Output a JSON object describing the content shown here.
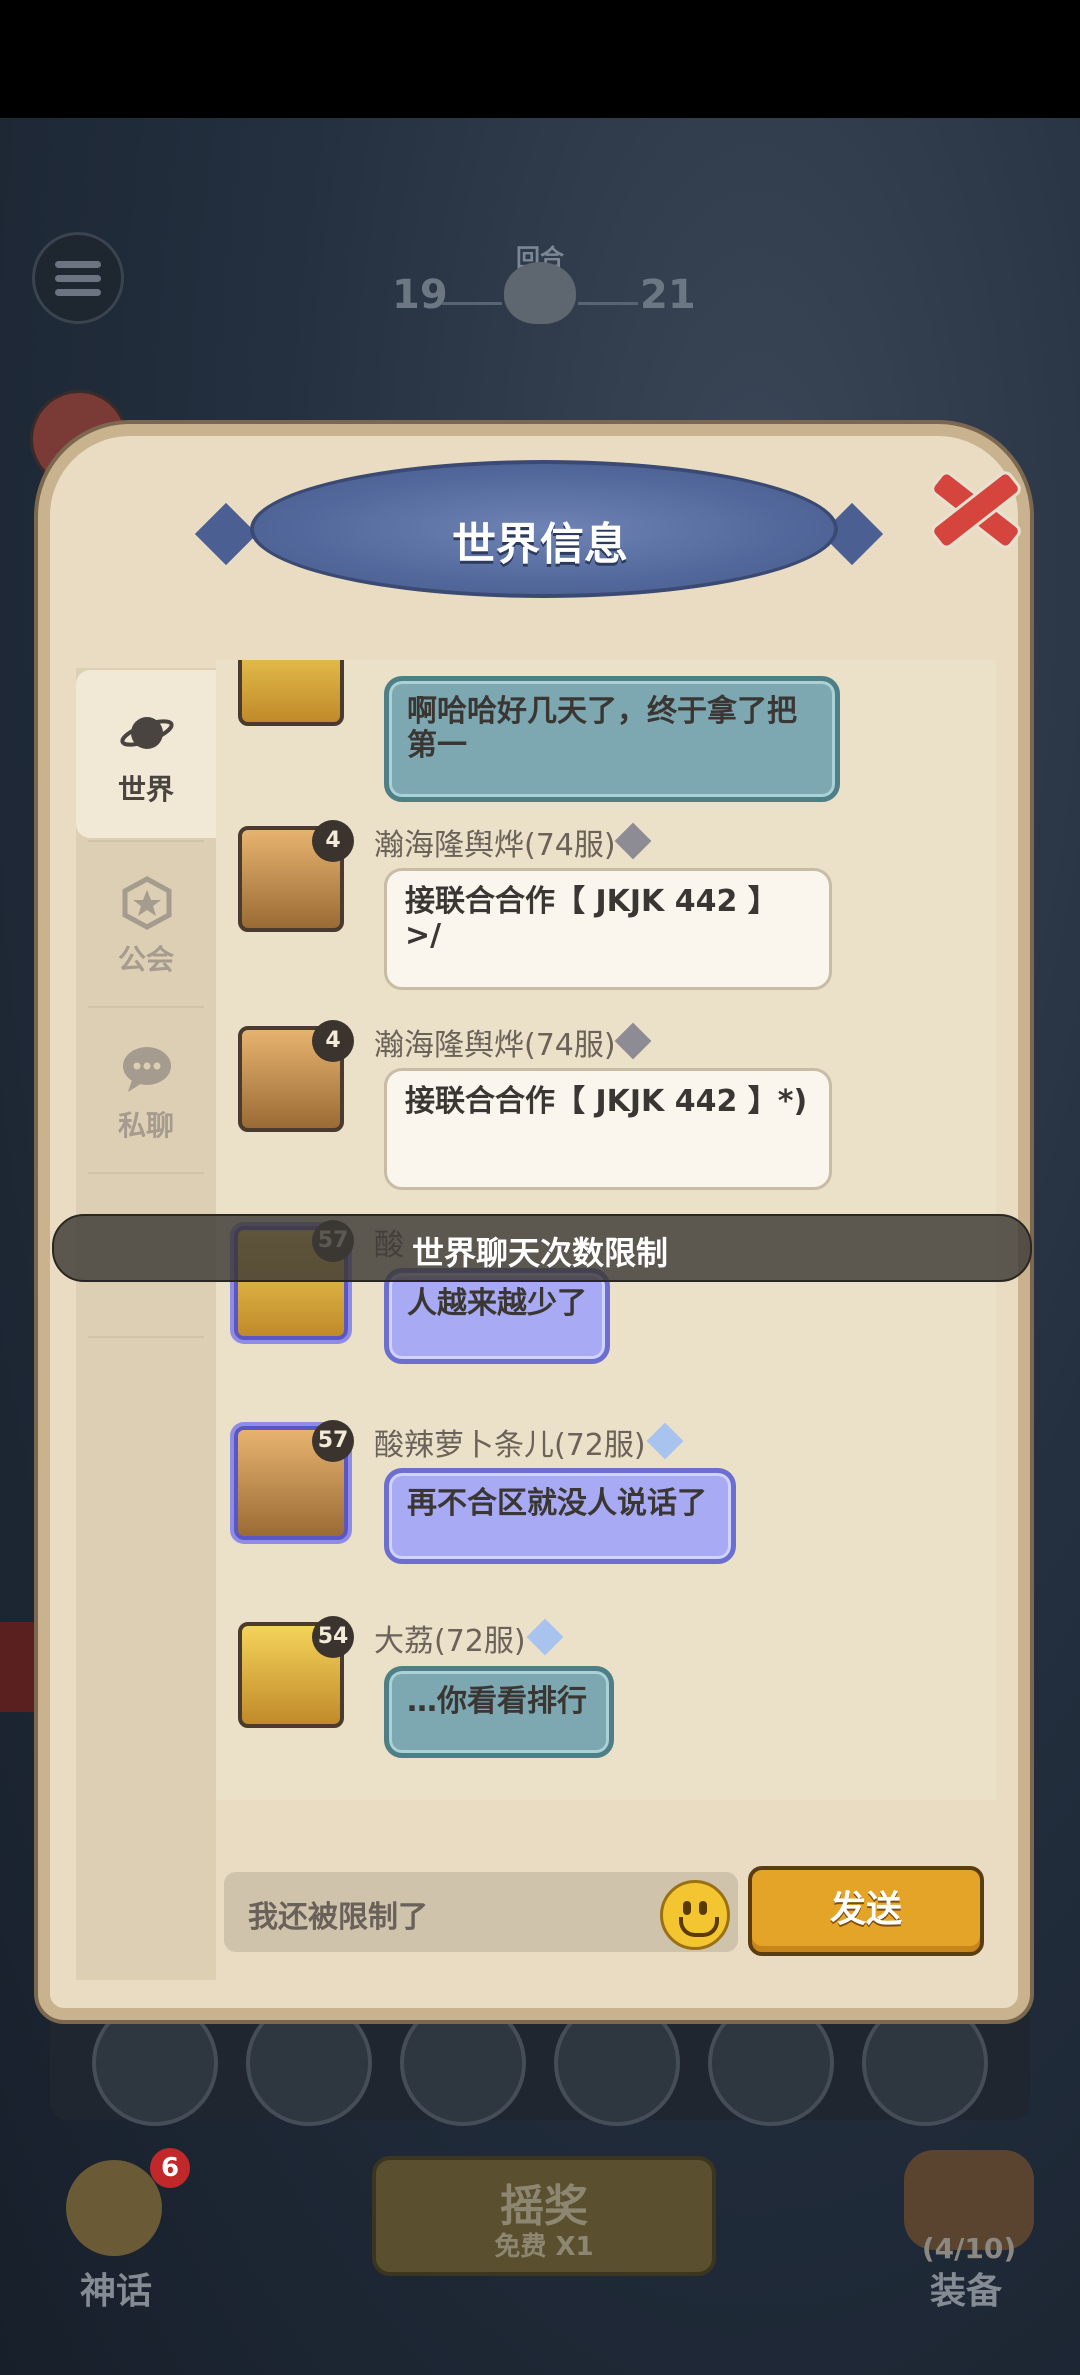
{
  "top_hud": {
    "round_label": "回合",
    "round_start": "19",
    "round_end": "21"
  },
  "modal": {
    "title": "世界信息",
    "tabs": [
      {
        "label": "世界",
        "icon": "planet-icon",
        "active": true
      },
      {
        "label": "公会",
        "icon": "guild-icon",
        "active": false
      },
      {
        "label": "私聊",
        "icon": "chat-icon",
        "active": false
      }
    ],
    "messages": [
      {
        "level": "",
        "name": "",
        "text": "啊哈哈好几天了，终于拿了把第一",
        "style": "teal"
      },
      {
        "level": "4",
        "name": "瀚海隆舆烨(74服)",
        "text": "接联合合作【 JKJK 442 】>/",
        "style": "white"
      },
      {
        "level": "4",
        "name": "瀚海隆舆烨(74服)",
        "text": "接联合合作【 JKJK 442 】*)",
        "style": "white"
      },
      {
        "level": "57",
        "name": "酸",
        "text": "人越来越少了",
        "style": "purple"
      },
      {
        "level": "57",
        "name": "酸辣萝卜条儿(72服)",
        "text": "再不合区就没人说话了",
        "style": "purple"
      },
      {
        "level": "54",
        "name": "大荔(72服)",
        "text": "…你看看排行",
        "style": "teal"
      }
    ],
    "toast": "世界聊天次数限制",
    "input_value": "我还被限制了",
    "send_label": "发送"
  },
  "bottom_bar": {
    "myth_label": "神话",
    "myth_badge": "6",
    "lottery_label": "摇奖",
    "lottery_sub": "免费 X1",
    "equip_count": "(4/10)",
    "equip_label": "装备"
  },
  "colors": {
    "send_button": "#e4a427",
    "title_banner": "#52679b",
    "close_x": "#d5453e"
  }
}
